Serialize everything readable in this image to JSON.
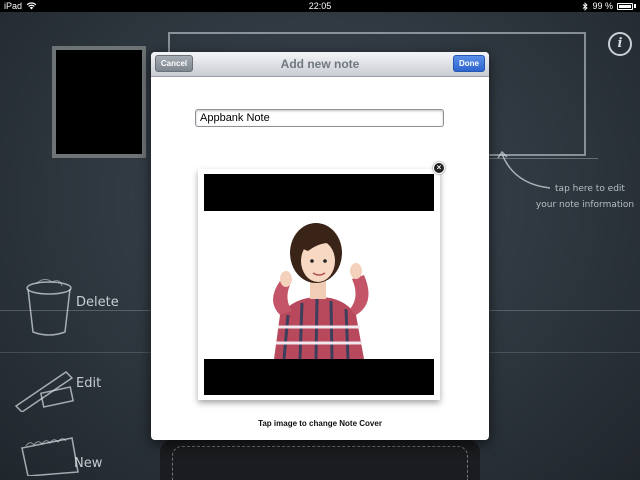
{
  "status_bar": {
    "device": "iPad",
    "time": "22:05",
    "battery_percent": "99 %"
  },
  "background": {
    "info_button": "i",
    "hint_line1": "tap here to edit",
    "hint_line2": "your note information",
    "delete_label": "Delete",
    "edit_label": "Edit",
    "new_label": "New"
  },
  "dialog": {
    "title": "Add new note",
    "cancel_label": "Cancel",
    "done_label": "Done",
    "note_title_value": "Appbank Note",
    "cover_caption": "Tap image to change Note Cover",
    "close_glyph": "×"
  },
  "colors": {
    "done_button": "#2d64cf",
    "cancel_button": "#7d858e",
    "chalkboard": "#2c343c"
  }
}
